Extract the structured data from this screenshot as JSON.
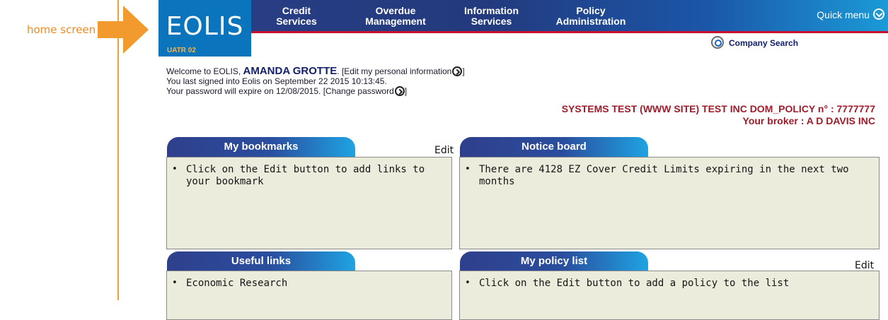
{
  "annotation": {
    "label": "home screen"
  },
  "header": {
    "logo_text": "EOLIS",
    "logo_sub": "UATR 02",
    "nav": [
      {
        "line1": "Credit",
        "line2": "Services"
      },
      {
        "line1": "Overdue",
        "line2": "Management"
      },
      {
        "line1": "Information",
        "line2": "Services"
      },
      {
        "line1": "Policy",
        "line2": "Administration"
      }
    ],
    "quick_menu": "Quick menu",
    "company_search": "Company  Search"
  },
  "welcome": {
    "prefix": "Welcome to EOLIS, ",
    "user_name": "AMANDA GROTTE",
    "edit_link": ". [Edit my personal information",
    "last_signed": "You last signed into Eolis on September 22 2015 10:13:45.",
    "password_prefix": "Your password will expire on 12/08/2015. [Change password",
    "close_bracket": "]"
  },
  "policy_info": {
    "policy_line": "SYSTEMS TEST (WWW SITE) TEST INC DOM_POLICY n° : 7777777",
    "broker_line": "Your broker : A D DAVIS INC"
  },
  "panels": {
    "bookmarks": {
      "title": "My bookmarks",
      "edit": "Edit",
      "items": [
        "Click on the Edit button to add links to your bookmark"
      ]
    },
    "notice": {
      "title": "Notice board",
      "items": [
        "There are 4128 EZ Cover Credit Limits expiring in the next two months"
      ]
    },
    "useful": {
      "title": "Useful links",
      "items": [
        "Economic Research"
      ]
    },
    "policy_list": {
      "title": "My policy list",
      "edit": "Edit",
      "items": [
        "Click on the Edit button to add a policy to the list"
      ]
    }
  },
  "colors": {
    "accent_red": "#c8102e",
    "nav_dark": "#2a3f86",
    "annotation": "#f08a1e"
  }
}
